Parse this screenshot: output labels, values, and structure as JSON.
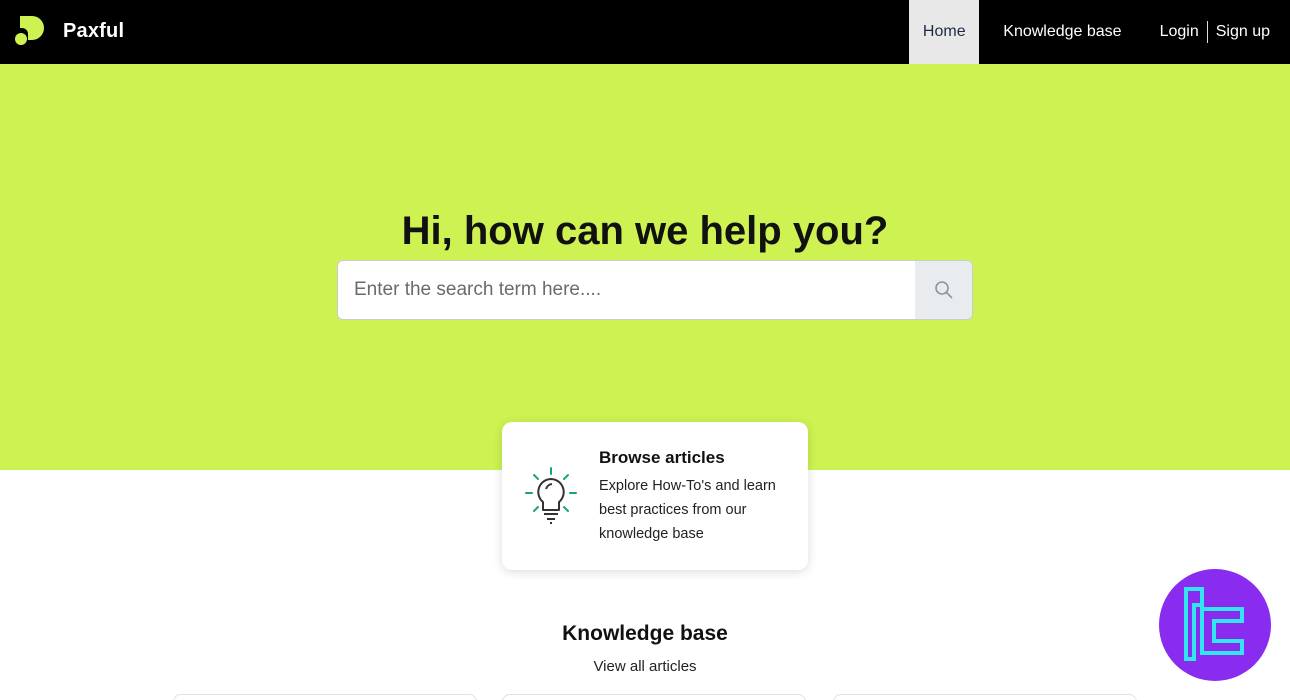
{
  "header": {
    "brand_name": "Paxful",
    "nav": {
      "home": "Home",
      "knowledge_base": "Knowledge base",
      "login": "Login",
      "signup": "Sign up"
    }
  },
  "hero": {
    "title": "Hi, how can we help you?",
    "search": {
      "placeholder": "Enter the search term here....",
      "value": ""
    }
  },
  "browse_card": {
    "title": "Browse articles",
    "description": "Explore How-To's and learn best practices from our knowledge base"
  },
  "knowledge_base": {
    "title": "Knowledge base",
    "link": "View all articles"
  },
  "colors": {
    "header_bg": "#000000",
    "hero_bg": "#cef252",
    "brand_accent": "#cef252",
    "icon_accent": "#1aa37a",
    "badge_bg": "#8a2cf0",
    "badge_fg": "#32e6f0"
  },
  "icons": {
    "logo": "paxful-logo-icon",
    "search": "search-icon",
    "browse": "lightbulb-icon",
    "badge": "tc-logo-icon"
  }
}
